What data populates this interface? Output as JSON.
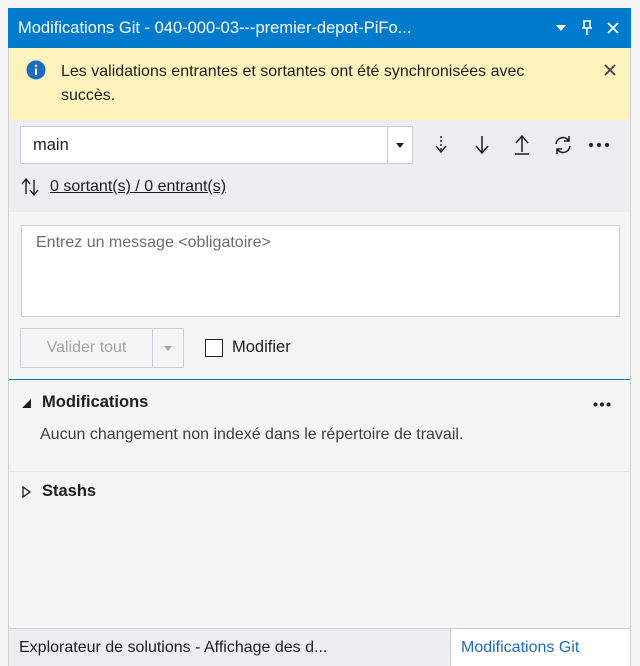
{
  "window": {
    "title": "Modifications Git - 040-000-03---premier-depot-PiFo...",
    "dropdown_icon": "chevron-down-icon",
    "pin_icon": "pin-icon",
    "close_icon": "close-icon"
  },
  "info_bar": {
    "message": "Les validations entrantes et sortantes ont été synchronisées avec succès.",
    "icon": "info-icon",
    "close_icon": "close-icon"
  },
  "branch": {
    "selected": "main"
  },
  "git_actions": {
    "fetch_icon": "fetch-icon",
    "pull_icon": "pull-icon",
    "push_icon": "push-icon",
    "sync_icon": "sync-icon",
    "more_icon": "more-icon"
  },
  "sync_status": {
    "label": "0 sortant(s) / 0 entrant(s)",
    "icon": "outgoing-incoming-icon"
  },
  "commit": {
    "message_placeholder": "Entrez un message <obligatoire>",
    "commit_all_label": "Valider tout",
    "amend_label": "Modifier",
    "amend_checked": false
  },
  "changes_section": {
    "title": "Modifications",
    "empty_message": "Aucun changement non indexé dans le répertoire de travail.",
    "expanded": true
  },
  "stashes_section": {
    "title": "Stashs",
    "expanded": false
  },
  "bottom_tabs": [
    {
      "label": "Explorateur de solutions - Affichage des d...",
      "active": false
    },
    {
      "label": "Modifications Git",
      "active": true
    }
  ],
  "colors": {
    "accent": "#007acc",
    "info_bar": "#fcf3bd",
    "active_tab_text": "#1c6cbf"
  }
}
